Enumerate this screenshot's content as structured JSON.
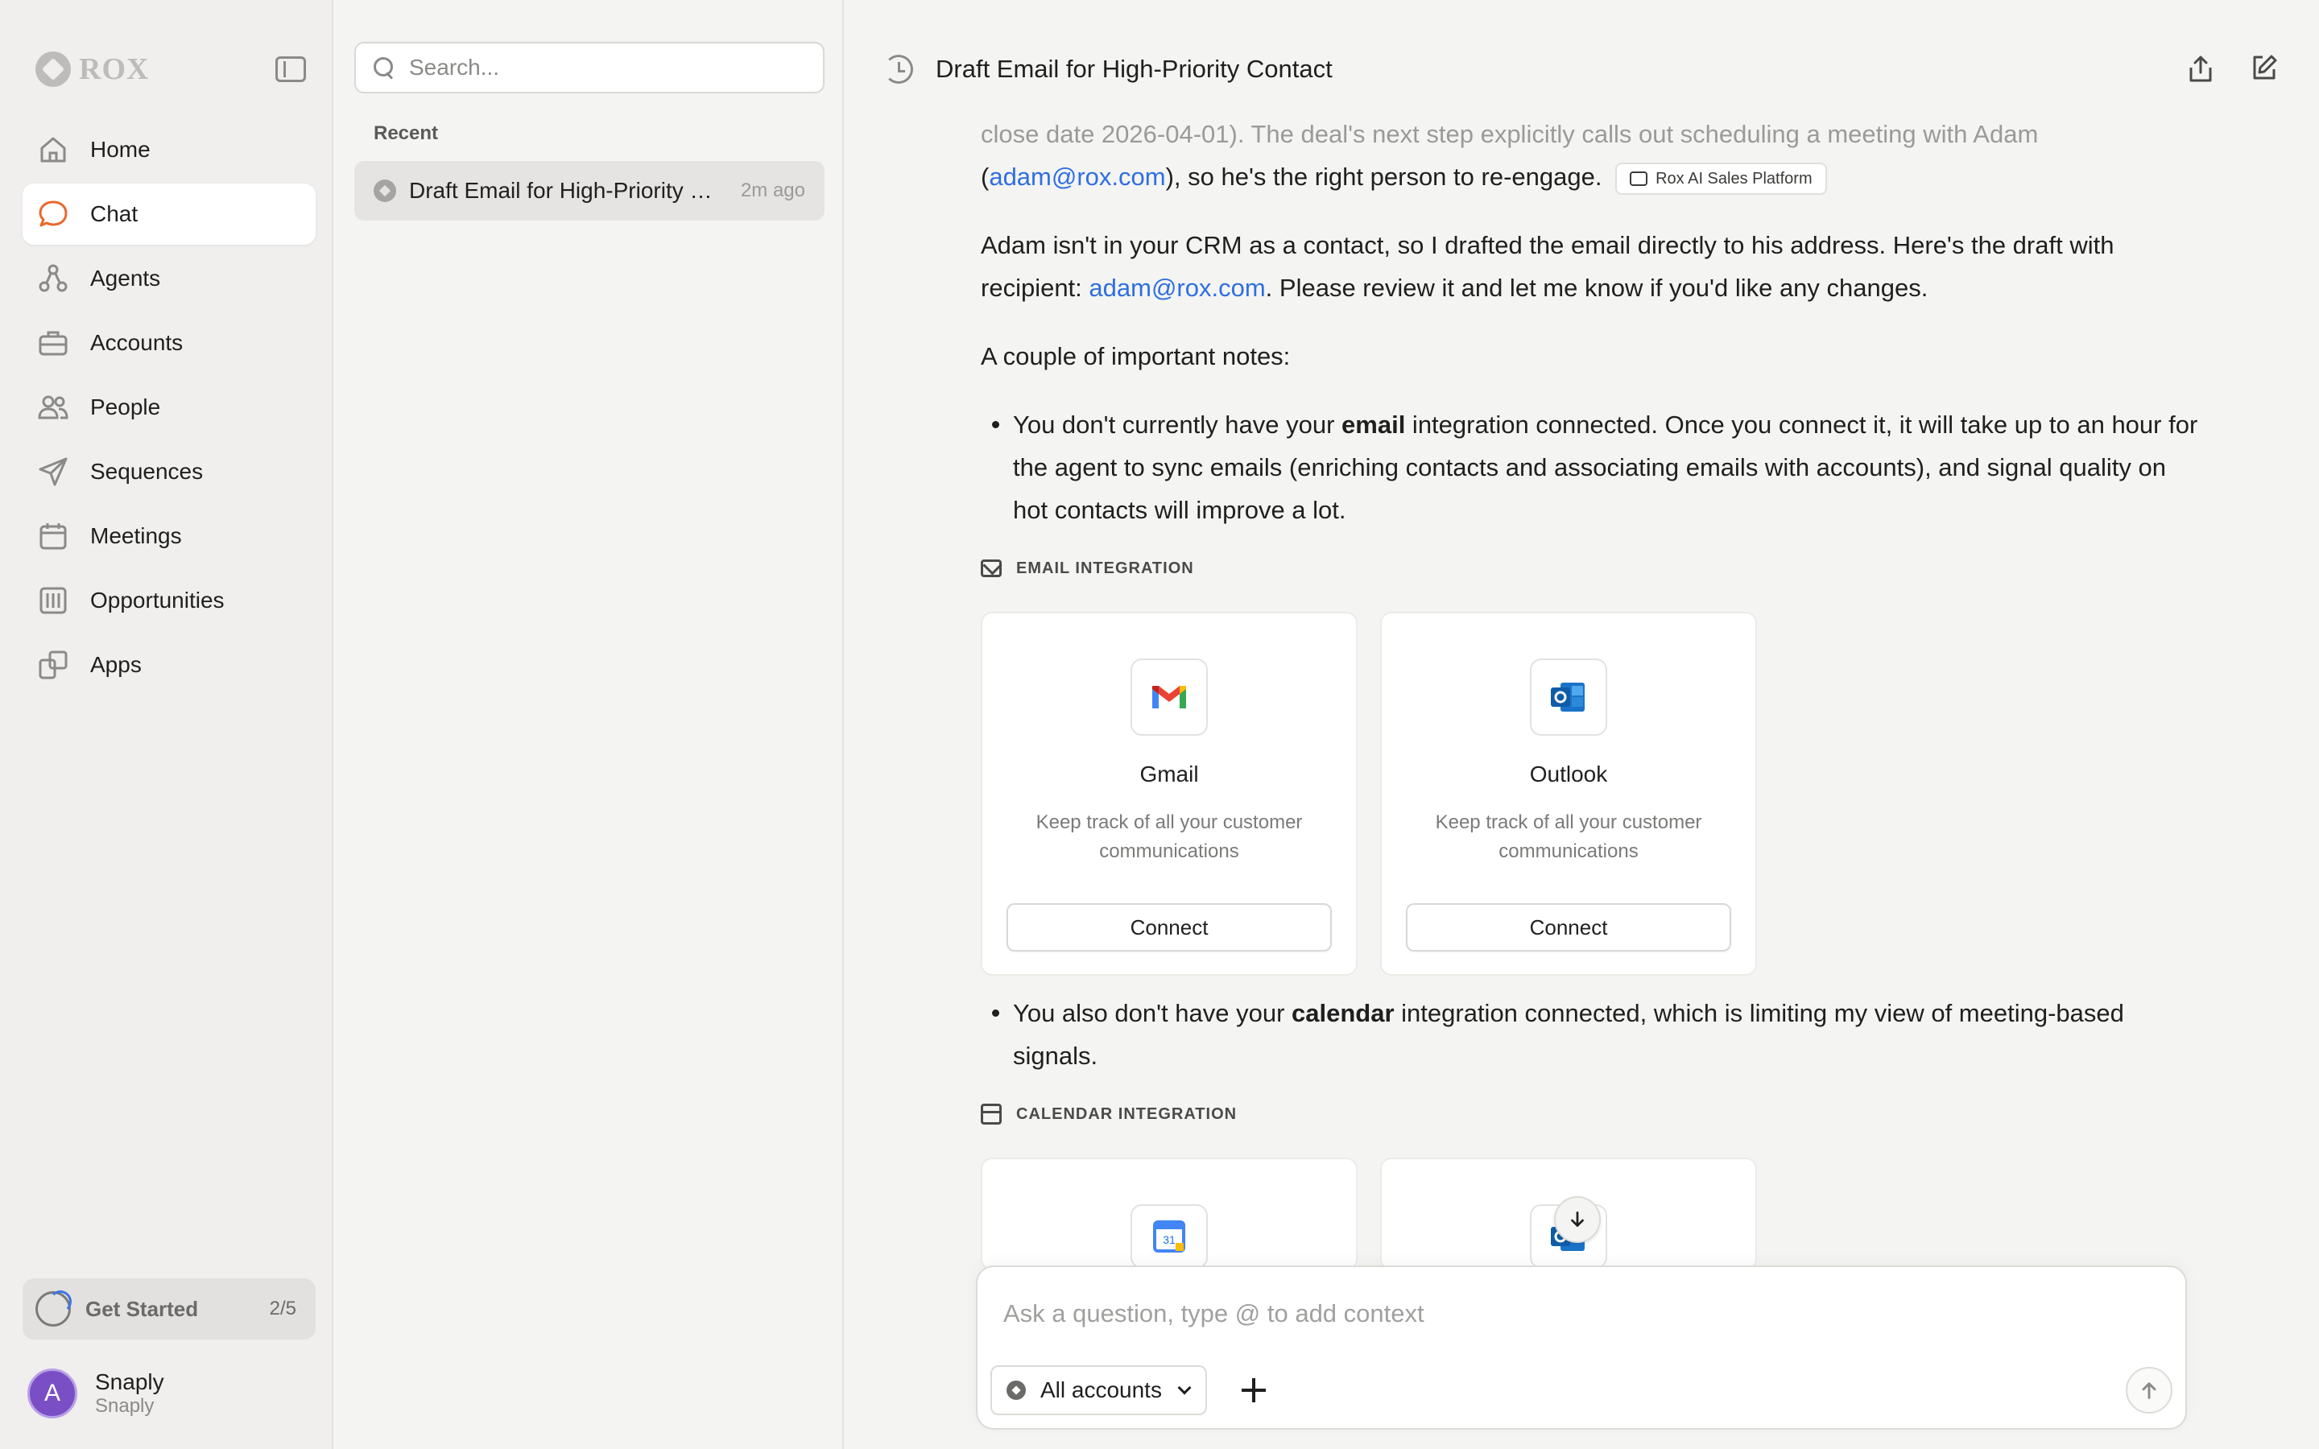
{
  "sidebar": {
    "brand": "ROX",
    "items": [
      {
        "label": "Home",
        "icon": "home-icon"
      },
      {
        "label": "Chat",
        "icon": "chat-icon",
        "active": true
      },
      {
        "label": "Agents",
        "icon": "agents-icon"
      },
      {
        "label": "Accounts",
        "icon": "briefcase-icon"
      },
      {
        "label": "People",
        "icon": "people-icon"
      },
      {
        "label": "Sequences",
        "icon": "send-icon"
      },
      {
        "label": "Meetings",
        "icon": "calendar-icon"
      },
      {
        "label": "Opportunities",
        "icon": "columns-icon"
      },
      {
        "label": "Apps",
        "icon": "apps-icon"
      }
    ],
    "get_started": {
      "label": "Get Started",
      "count": "2/5"
    },
    "user": {
      "initial": "A",
      "name": "Snaply",
      "org": "Snaply"
    }
  },
  "history": {
    "search_placeholder": "Search...",
    "recent_label": "Recent",
    "items": [
      {
        "title": "Draft Email for High-Priority Contact",
        "time": "2m ago"
      }
    ]
  },
  "main": {
    "title": "Draft Email for High-Priority Contact",
    "msg": {
      "line_faded": "close date 2026-04-01). The deal's next step explicitly calls out scheduling a meeting with Adam",
      "p1_pre": "(",
      "p1_link": "adam@rox.com",
      "p1_post": "), so he's the right person to re-engage.",
      "source_chip": "Rox AI Sales Platform",
      "p2_pre": "Adam isn't in your CRM as a contact, so I drafted the email directly to his address. Here's the draft with recipient: ",
      "p2_link": "adam@rox.com",
      "p2_post": ". Please review it and let me know if you'd like any changes.",
      "p3": "A couple of important notes:",
      "b1_pre": "You don't currently have your ",
      "b1_bold": "email",
      "b1_post": " integration connected. Once you connect it, it will take up to an hour for the agent to sync emails (enriching contacts and associating emails with accounts), and signal quality on hot contacts will improve a lot.",
      "email_section": "EMAIL INTEGRATION",
      "email_cards": [
        {
          "name": "Gmail",
          "desc": "Keep track of all your customer communications",
          "button": "Connect"
        },
        {
          "name": "Outlook",
          "desc": "Keep track of all your customer communications",
          "button": "Connect"
        }
      ],
      "b2_pre": "You also don't have your ",
      "b2_bold": "calendar",
      "b2_post": " integration connected, which is limiting my view of meeting-based signals.",
      "calendar_section": "CALENDAR INTEGRATION"
    },
    "composer": {
      "placeholder": "Ask a question, type @ to add context",
      "account_select": "All accounts"
    },
    "colors": {
      "accent": "#2f6fe0",
      "chat_icon": "#e8692c"
    }
  }
}
